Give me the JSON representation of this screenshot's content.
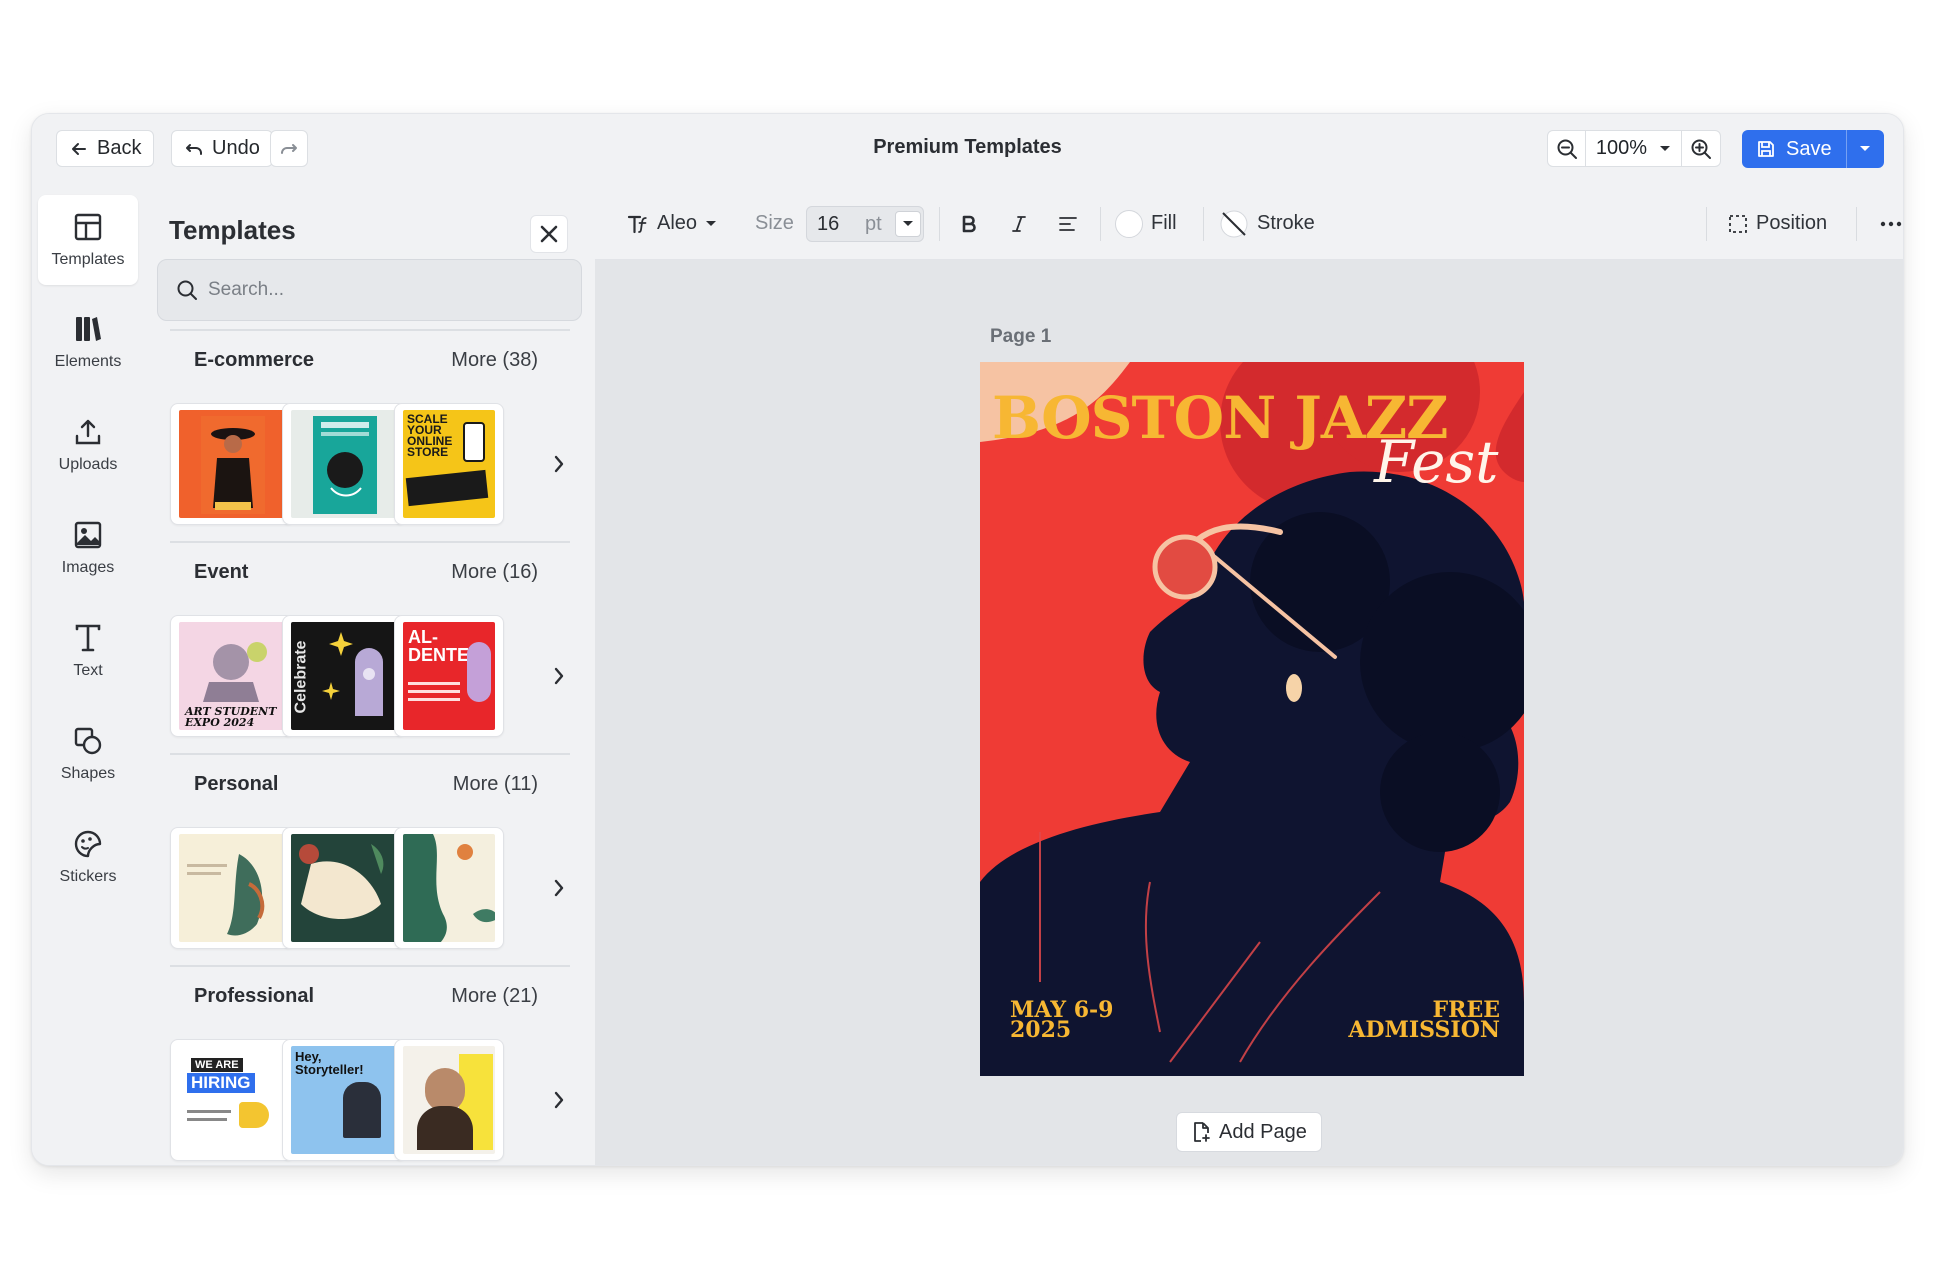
{
  "topbar": {
    "back_label": "Back",
    "undo_label": "Undo",
    "title": "Premium Templates",
    "zoom_value": "100%",
    "save_label": "Save"
  },
  "rail": {
    "items": [
      {
        "label": "Templates",
        "icon": "templates-icon"
      },
      {
        "label": "Elements",
        "icon": "elements-icon"
      },
      {
        "label": "Uploads",
        "icon": "upload-icon"
      },
      {
        "label": "Images",
        "icon": "image-icon"
      },
      {
        "label": "Text",
        "icon": "text-icon"
      },
      {
        "label": "Shapes",
        "icon": "shapes-icon"
      },
      {
        "label": "Stickers",
        "icon": "sticker-icon"
      }
    ]
  },
  "panel": {
    "title": "Templates",
    "search_placeholder": "Search...",
    "categories": [
      {
        "name": "E-commerce",
        "more": "More (38)"
      },
      {
        "name": "Event",
        "more": "More (16)"
      },
      {
        "name": "Personal",
        "more": "More (11)"
      },
      {
        "name": "Professional",
        "more": "More (21)"
      }
    ],
    "thumb_text": {
      "scale": "SCALE YOUR ONLINE STORE",
      "artstudent": "ART STUDENT EXPO 2024",
      "celebrate": "Celebrate",
      "aldente": "AL-DENTE",
      "hiring_top": "WE ARE",
      "hiring": "HIRING",
      "story": "Hey, Storyteller!"
    }
  },
  "toolbar": {
    "font": "Aleo",
    "size_label": "Size",
    "size_value": "16",
    "size_unit": "pt",
    "fill_label": "Fill",
    "stroke_label": "Stroke",
    "position_label": "Position"
  },
  "canvas": {
    "page_label": "Page  1",
    "add_page_label": "Add Page",
    "poster": {
      "title": "BOSTON JAZZ",
      "subtitle": "Fest",
      "date_line1": "MAY 6-9",
      "date_line2": "2025",
      "free_line1": "FREE",
      "free_line2": "ADMISSION"
    }
  },
  "colors": {
    "accent": "#2f6fed",
    "poster_red": "#ef3b35",
    "poster_gold": "#f7b733",
    "poster_navy": "#0f1430"
  }
}
